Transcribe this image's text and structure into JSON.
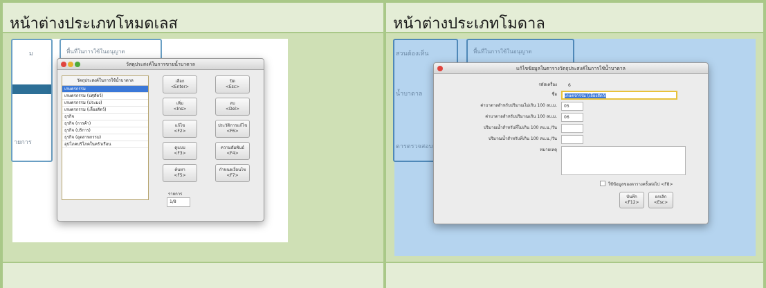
{
  "table": {
    "left_header": "หน้าต่างประเภทโหมดเลส",
    "right_header": "หน้าต่างประเภทโมดาล"
  },
  "modeless": {
    "bg_tab_partial": "ม",
    "bg_panel_title": "พื้นที่ในการใช้ในอนุญาต",
    "bg_side_text": "ายการ",
    "window_title": "วัสดุประสงค์ในการขายน้ำบาดาล",
    "list_title": "วัตถุประสงค์ในการใช้น้ำบาดาล",
    "list_items": [
      "เกษตรกรรม",
      "เกษตรกรรม (ปศุสัตว์)",
      "เกษตรกรรม (ประมง)",
      "เกษตรกรรม (เลี้ยงสัตว์)",
      "ธุรกิจ",
      "ธุรกิจ (การค้า)",
      "ธุรกิจ (บริการ)",
      "ธุรกิจ (อุตสาหกรรม)",
      "อุปโภคบริโภคในครัวเรือน"
    ],
    "buttons": [
      {
        "label": "เลือก",
        "key": "<Enter>"
      },
      {
        "label": "ปิด",
        "key": "<Esc>"
      },
      {
        "label": "เพิ่ม",
        "key": "<Ins>"
      },
      {
        "label": "ลบ",
        "key": "<Del>"
      },
      {
        "label": "แก้ไข",
        "key": "<F2>"
      },
      {
        "label": "ประวัติการแก้ไข",
        "key": "<F6>"
      },
      {
        "label": "ดูแบบ",
        "key": "<F3>"
      },
      {
        "label": "ความสัมพันธ์",
        "key": "<F4>"
      },
      {
        "label": "ค้นหา",
        "key": "<F5>"
      },
      {
        "label": "กำหนดเงื่อนไข",
        "key": "<F7>"
      }
    ],
    "record_label": "รายการ",
    "record_value": "1/8"
  },
  "modal": {
    "bg_left_top": "สวนต้องเห็น",
    "bg_panel_title": "พื้นที่ในการใช้ในอนุญาต",
    "bg_left_mid": "น้ำบาดาล",
    "bg_left_bottom": "ดารตรวจสอบ",
    "window_title": "แก้ไขข้อมูลในตารางวัตถุประสงค์ในการใช้น้ำบาดาล",
    "fields": [
      {
        "label": "รหัสเครื่อง",
        "value": "6"
      },
      {
        "label": "ชื่อ",
        "value": "เกษตรกรรม (เลี้ยงสัตว์)"
      },
      {
        "label": "ค่าบาดาลสำหรับปริมาณไม่เกิน 100 ลบ.ม.",
        "value": "05"
      },
      {
        "label": "ค่าบาดาลสำหรับปริมาณเกิน 100 ลบ.ม.",
        "value": "06"
      },
      {
        "label": "ปริมาณน้ำสำหรับที่ไม่เกิน 100 ลบ.ม./วัน",
        "value": ""
      },
      {
        "label": "ปริมาณน้ำสำหรับที่เกิน 100 ลบ.ม./วัน",
        "value": ""
      },
      {
        "label": "หมายเหตุ",
        "value": ""
      }
    ],
    "checkbox_label": "ใช้ข้อมูลของตารางครั้งต่อไป <F8>",
    "save_label": "บันทึก",
    "save_key": "<F12>",
    "cancel_label": "ยกเลิก",
    "cancel_key": "<Esc>"
  }
}
